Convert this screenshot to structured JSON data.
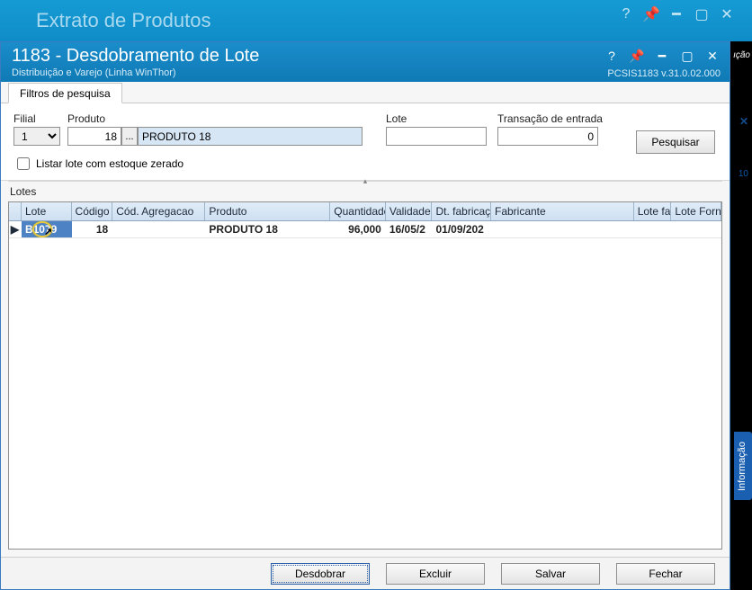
{
  "bgWindow": {
    "title": "Extrato de Produtos"
  },
  "window": {
    "title": "1183 - Desdobramento de Lote",
    "subtitle": "Distribuição e Varejo (Linha WinThor)",
    "version": "PCSIS1183  v.31.0.02.000"
  },
  "tabs": {
    "search": "Filtros de pesquisa"
  },
  "filters": {
    "filialLabel": "Filial",
    "filialValue": "1",
    "produtoLabel": "Produto",
    "produtoCode": "18",
    "produtoName": "PRODUTO 18",
    "loteLabel": "Lote",
    "loteValue": "",
    "transacaoLabel": "Transação de entrada",
    "transacaoValue": "0",
    "listZero": "Listar lote com estoque zerado",
    "pesquisar": "Pesquisar",
    "lookup": "..."
  },
  "section": {
    "lotes": "Lotes"
  },
  "grid": {
    "headers": [
      "",
      "Lote",
      "Código",
      "Cód. Agregacao",
      "Produto",
      "Quantidade",
      "Validade",
      "Dt. fabricaçã",
      "Fabricante",
      "Lote fa",
      "Lote Forne"
    ],
    "row": {
      "marker": "▶",
      "lote": "B1079",
      "codigo": "18",
      "agreg": "",
      "produto": "PRODUTO 18",
      "qtd": "96,000",
      "validade": "16/05/2",
      "fabric": "01/09/202",
      "fabricante": "",
      "lotefa": "",
      "loteforn": ""
    }
  },
  "buttons": {
    "desdobrar": "Desdobrar",
    "excluir": "Excluir",
    "salvar": "Salvar",
    "fechar": "Fechar"
  },
  "side": {
    "info": "Informação",
    "num": "10",
    "ica": "ıção"
  }
}
